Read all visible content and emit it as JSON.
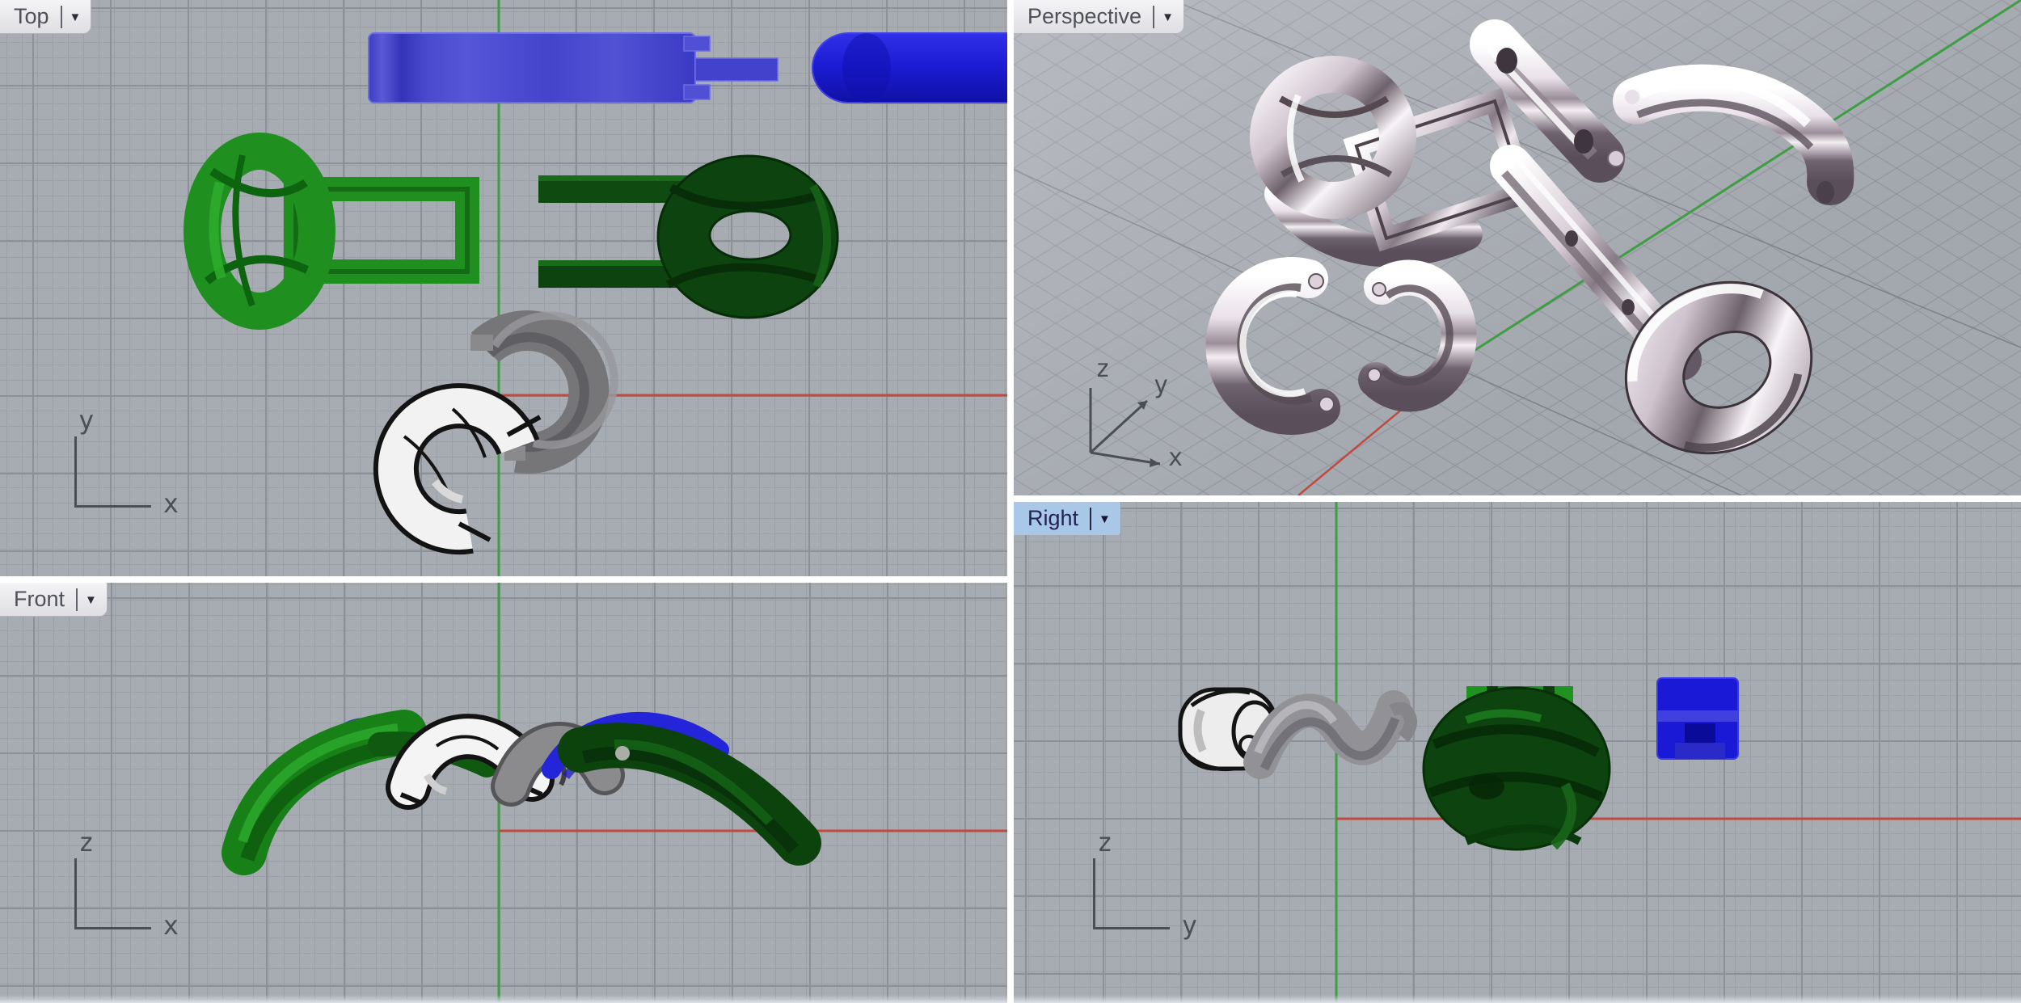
{
  "viewports": {
    "top": {
      "label": "Top",
      "axes": {
        "vertical": "y",
        "horizontal": "x"
      }
    },
    "perspective": {
      "label": "Perspective",
      "axes": {
        "up": "z",
        "diag_up": "y",
        "diag_down": "x"
      }
    },
    "front": {
      "label": "Front",
      "axes": {
        "vertical": "z",
        "horizontal": "x"
      }
    },
    "right": {
      "label": "Right",
      "active": true,
      "axes": {
        "vertical": "z",
        "horizontal": "y"
      }
    }
  },
  "icons": {
    "viewport_dropdown": "▼"
  },
  "colors": {
    "viewport_background": "#a7abb2",
    "grid_minor": "#9a9ea5",
    "grid_major": "#8d9097",
    "axis_green": "#3f9e44",
    "axis_red": "#bf4a40",
    "divider": "#ffffff",
    "tab_background": "#ececee",
    "tab_text": "#4f4f5a",
    "active_tab_background": "#a9c7e7",
    "active_tab_text": "#232355",
    "object_blue": "#2222d8",
    "object_green_bright": "#1f8f1f",
    "object_green_dark": "#0d430e",
    "object_gray": "#7b7b7d",
    "selected_object_white": "#f2f2f2",
    "chrome_light": "#f5f0f5",
    "chrome_dark": "#5f5560"
  }
}
